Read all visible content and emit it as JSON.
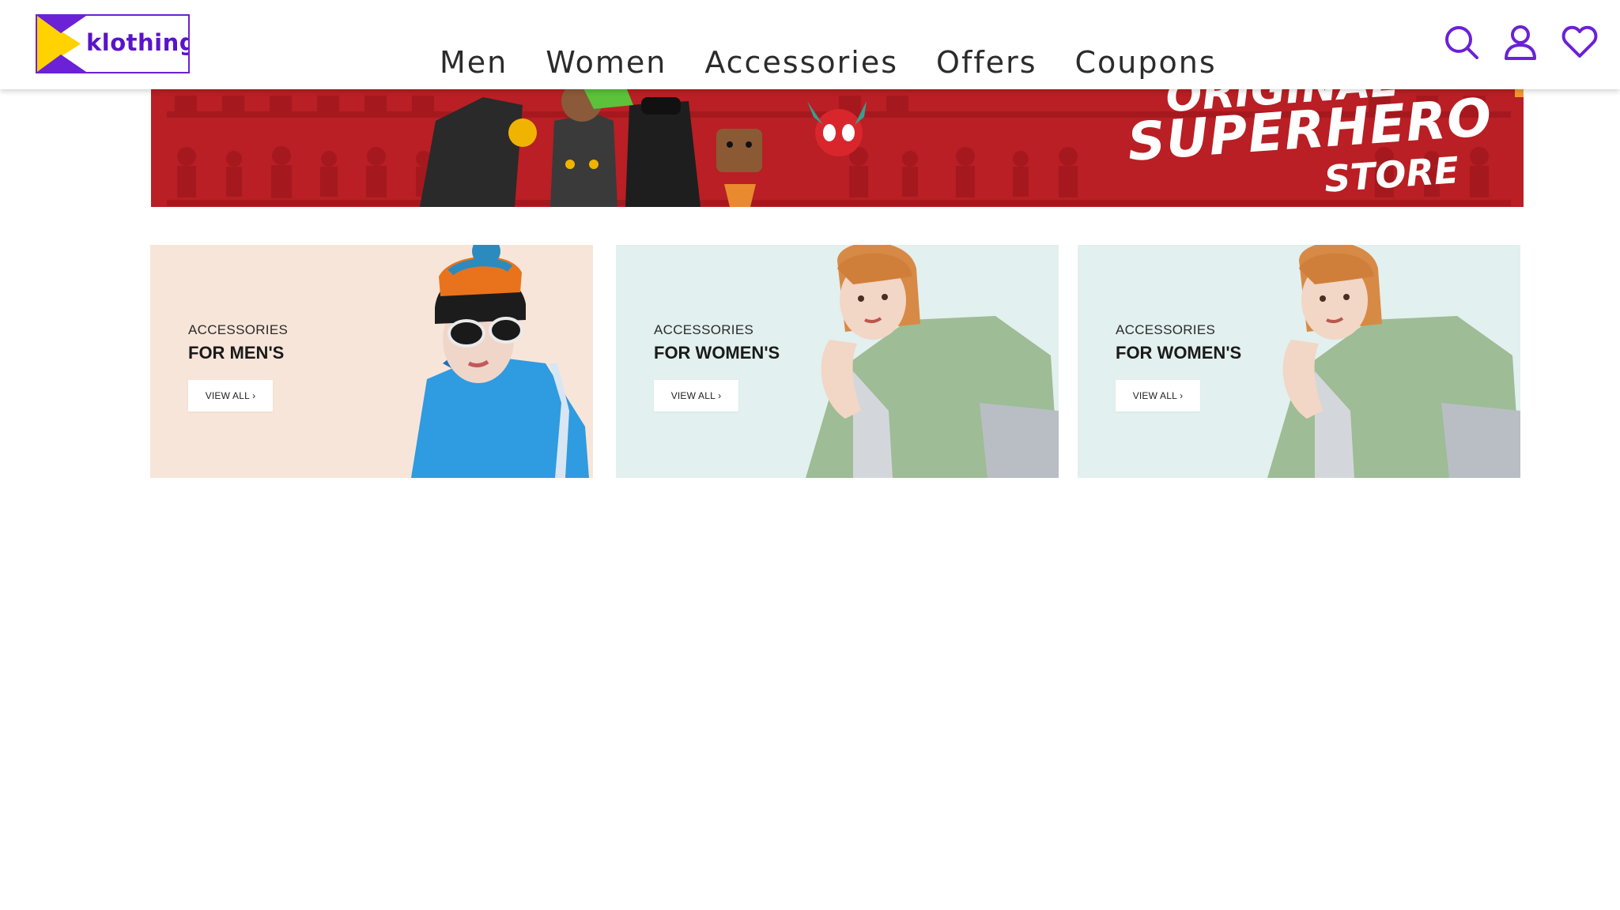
{
  "brand": {
    "name": "klothings",
    "colors": {
      "purple": "#6b21d6",
      "yellow": "#ffd200",
      "icon": "#6b21d6"
    }
  },
  "nav": {
    "items": [
      {
        "label": "Men"
      },
      {
        "label": "Women"
      },
      {
        "label": "Accessories"
      },
      {
        "label": "Offers"
      },
      {
        "label": "Coupons"
      }
    ]
  },
  "header_icons": [
    "search-icon",
    "user-icon",
    "heart-icon"
  ],
  "hero": {
    "title_top": "ORIGINAL",
    "title": "SUPERHERO",
    "subtitle": "STORE",
    "colors": {
      "background": "#b91f24",
      "accent": "#f29a2e"
    }
  },
  "promos": [
    {
      "kicker": "ACCESSORIES",
      "title": "FOR MEN'S",
      "button": "VIEW ALL",
      "background": "#f8e5d9"
    },
    {
      "kicker": "ACCESSORIES",
      "title": "FOR WOMEN'S",
      "button": "VIEW ALL",
      "background": "#e2f0ef"
    },
    {
      "kicker": "ACCESSORIES",
      "title": "FOR WOMEN'S",
      "button": "VIEW ALL",
      "background": "#e2f0ef"
    }
  ]
}
